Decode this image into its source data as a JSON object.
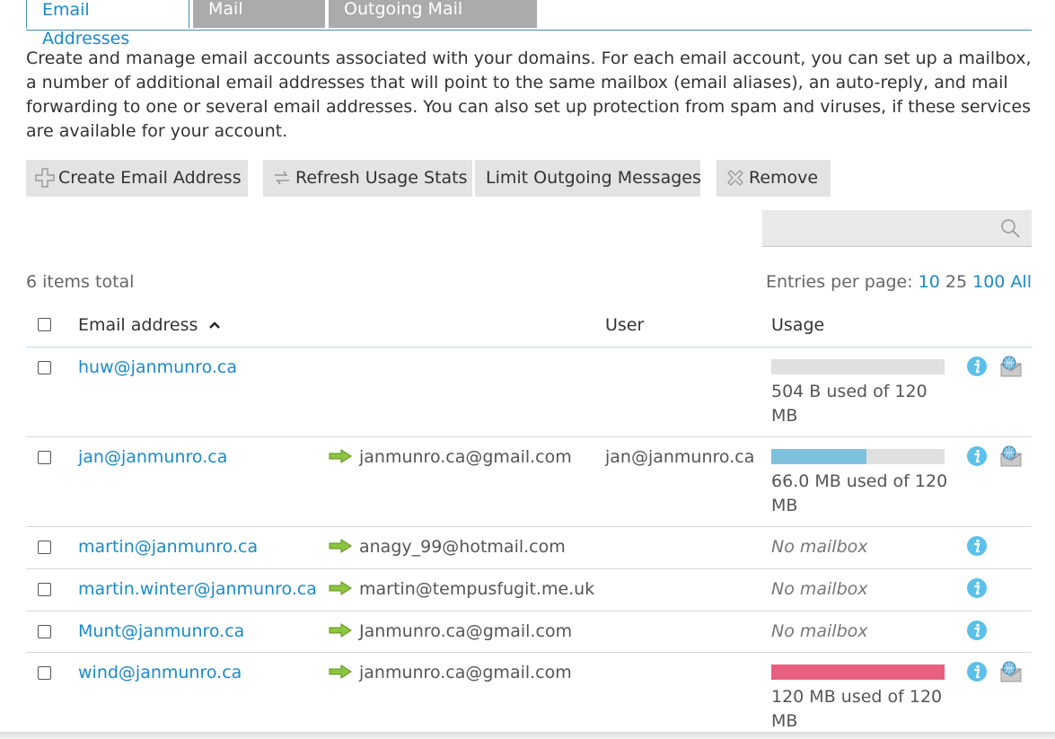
{
  "tabs": [
    {
      "label": "Email Addresses",
      "active": true
    },
    {
      "label": "Mail Settings",
      "active": false
    },
    {
      "label": "Outgoing Mail Control",
      "active": false
    }
  ],
  "description": "Create and manage email accounts associated with your domains. For each email account, you can set up a mailbox, a number of additional email addresses that will point to the same mailbox (email aliases), an auto-reply, and mail forwarding to one or several email addresses. You can also set up protection from spam and viruses, if these services are available for your account.",
  "toolbar": {
    "create": {
      "label": "Create Email Address",
      "icon": "plus-icon"
    },
    "refresh": {
      "label": "Refresh Usage Stats",
      "icon": "refresh-icon"
    },
    "limit": {
      "label": "Limit Outgoing Messages"
    },
    "remove": {
      "label": "Remove",
      "icon": "remove-icon"
    }
  },
  "search": {
    "value": "",
    "icon": "search-icon"
  },
  "list": {
    "total": "6 items total",
    "entries_label": "Entries per page:",
    "entries_options": [
      "10",
      "25",
      "100",
      "All"
    ],
    "current_entries": "25"
  },
  "columns": {
    "email": "Email address",
    "user": "User",
    "usage": "Usage"
  },
  "colors": {
    "link": "#1a8ac7",
    "bar_normal": "#7ec1dd",
    "bar_full": "#e8607f",
    "bar_empty": "#e0e0e0",
    "tab_inactive": "#ababab"
  },
  "rows": [
    {
      "email": "huw@janmunro.ca",
      "forward": "",
      "user": "",
      "usage_text": "504 B used of 120 MB",
      "usage_fraction": 0.0,
      "has_mailbox": true
    },
    {
      "email": "jan@janmunro.ca",
      "forward": "janmunro.ca@gmail.com",
      "user": "jan@janmunro.ca",
      "usage_text": "66.0 MB used of 120 MB",
      "usage_fraction": 0.55,
      "has_mailbox": true
    },
    {
      "email": "martin@janmunro.ca",
      "forward": "anagy_99@hotmail.com",
      "user": "",
      "usage_text": "No mailbox",
      "has_mailbox": false
    },
    {
      "email": "martin.winter@janmunro.ca",
      "forward": "martin@tempusfugit.me.uk",
      "user": "",
      "usage_text": "No mailbox",
      "has_mailbox": false
    },
    {
      "email": "Munt@janmunro.ca",
      "forward": "Janmunro.ca@gmail.com",
      "user": "",
      "usage_text": "No mailbox",
      "has_mailbox": false
    },
    {
      "email": "wind@janmunro.ca",
      "forward": "janmunro.ca@gmail.com",
      "user": "",
      "usage_text": "120 MB used of 120 MB",
      "usage_fraction": 1.0,
      "has_mailbox": true
    }
  ]
}
